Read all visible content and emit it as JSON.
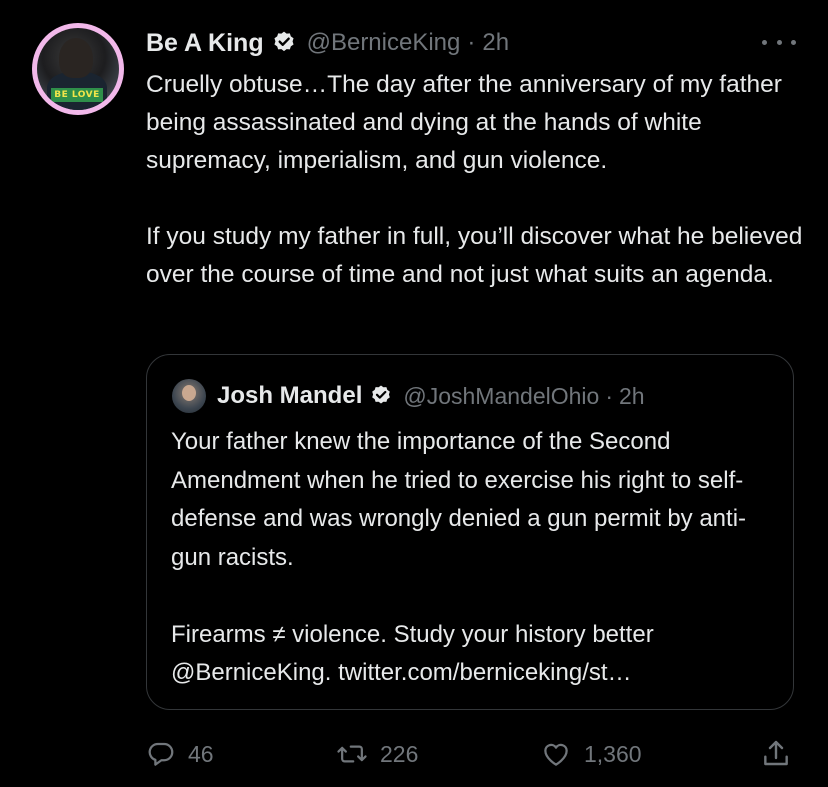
{
  "tweet": {
    "author_name": "Be A King",
    "handle": "@BerniceKing",
    "separator": "·",
    "time": "2h",
    "avatar_badge": "BE LOVE",
    "paragraphs": [
      "Cruelly obtuse…The day after the anniversary of my father being assassinated and dying at the hands of white supremacy, imperialism, and gun violence.",
      "If you study my father in full, you’ll discover what he believed over the course of time and not just what suits an agenda."
    ]
  },
  "quoted_tweet": {
    "author_name": "Josh Mandel",
    "handle": "@JoshMandelOhio",
    "separator": "·",
    "time": "2h",
    "paragraphs": [
      "Your father knew the importance of the Second Amendment when he tried to exercise his right to self-defense and was wrongly denied a gun permit by anti-gun racists.",
      "Firearms ≠ violence. Study your history better @BerniceKing. twitter.com/berniceking/st…"
    ]
  },
  "actions": {
    "replies": "46",
    "retweets": "226",
    "likes": "1,360"
  },
  "icons": {
    "verified": "verified-badge-icon",
    "more": "more-options-icon",
    "reply": "reply-icon",
    "retweet": "retweet-icon",
    "like": "heart-icon",
    "share": "share-icon"
  },
  "colors": {
    "background": "#000000",
    "text_primary": "#e7e9ea",
    "text_secondary": "#71767b",
    "border": "#333639",
    "avatar_ring": "#f2b8ea"
  }
}
